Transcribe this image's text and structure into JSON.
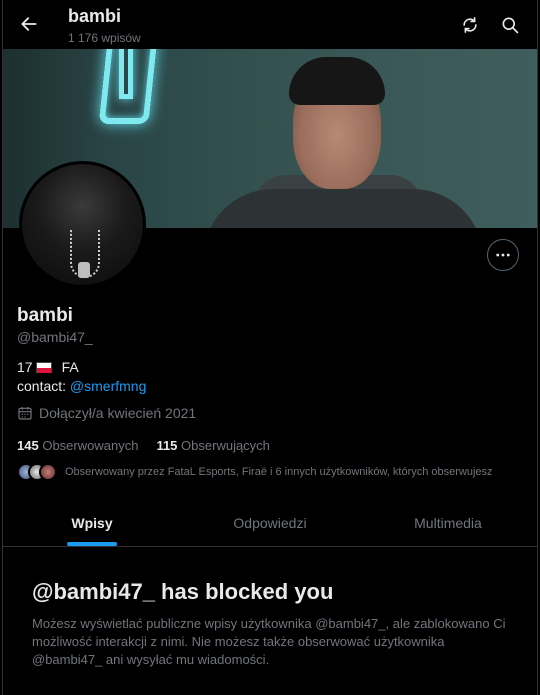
{
  "header": {
    "title": "bambi",
    "subtitle": "1 176 wpisów",
    "back_icon": "arrow-left-icon",
    "refresh_icon": "refresh-icon",
    "search_icon": "search-icon"
  },
  "profile": {
    "name": "bambi",
    "handle": "@bambi47_",
    "bio_line1_prefix": "17",
    "bio_line1_suffix": "FA",
    "bio_line2_prefix": "contact:",
    "bio_line2_link": "@smerfmng",
    "joined": "Dołączył/a kwiecień 2021",
    "following_count": "145",
    "following_label": "Obserwowanych",
    "followers_count": "115",
    "followers_label": "Obserwujących",
    "followed_by": "Obserwowany przez FataL Esports, Firaë i 6 innych użytkowników, których obserwujesz"
  },
  "tabs": [
    {
      "label": "Wpisy",
      "active": true
    },
    {
      "label": "Odpowiedzi",
      "active": false
    },
    {
      "label": "Multimedia",
      "active": false
    }
  ],
  "blocked": {
    "title": "@bambi47_ has blocked you",
    "text": "Możesz wyświetlać publiczne wpisy użytkownika @bambi47_, ale zablokowano Ci możliwość interakcji z nimi. Nie możesz także obserwować użytkownika @bambi47_ ani wysyłać mu wiadomości."
  },
  "colors": {
    "accent": "#1d9bf0",
    "text_primary": "#e7e9ea",
    "text_secondary": "#71767b",
    "background": "#000000"
  }
}
